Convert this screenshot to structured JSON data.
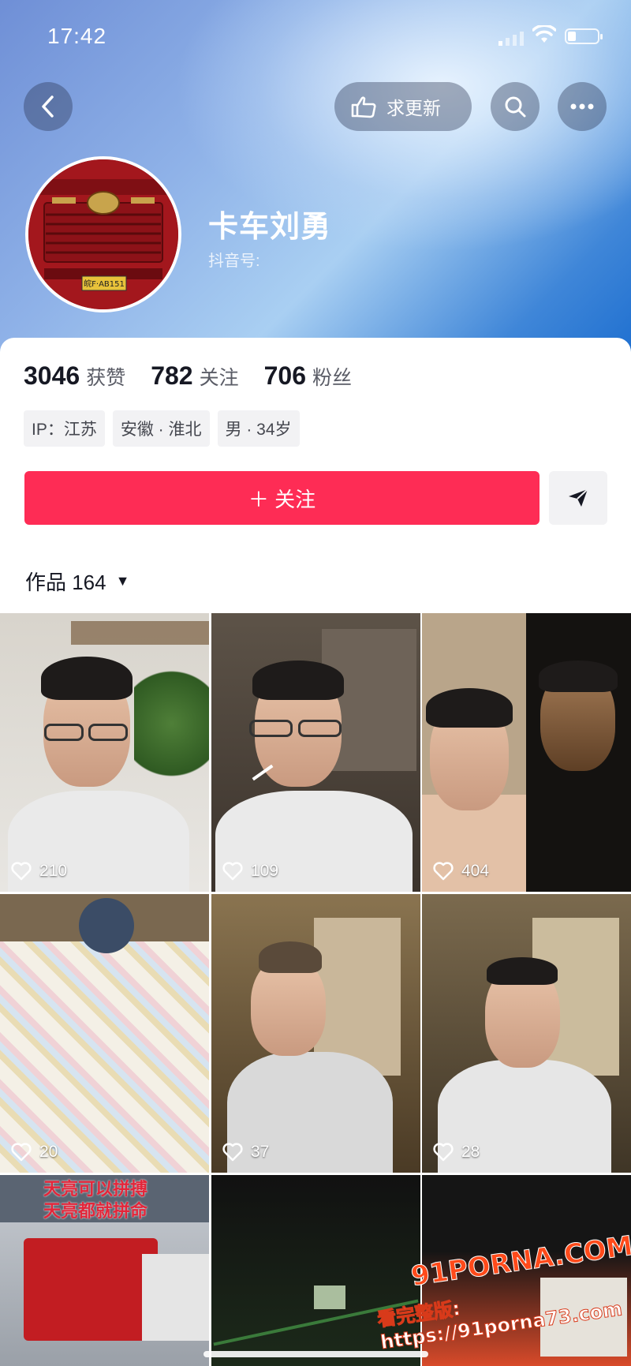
{
  "status_bar": {
    "time": "17:42"
  },
  "header": {
    "back_icon": "chevron-left-icon",
    "update_button_label": "求更新",
    "search_icon": "search-icon",
    "more_icon": "more-icon"
  },
  "profile": {
    "name": "卡车刘勇",
    "douyin_id_label": "抖音号:",
    "plate_text": "皖F·AB151"
  },
  "stats": [
    {
      "value": "3046",
      "label": "获赞"
    },
    {
      "value": "782",
      "label": "关注"
    },
    {
      "value": "706",
      "label": "粉丝"
    }
  ],
  "tags": [
    "IP：江苏",
    "安徽 · 淮北",
    "男 · 34岁"
  ],
  "actions": {
    "follow_label": "＋ 关注"
  },
  "works": {
    "label": "作品 164"
  },
  "videos": [
    {
      "likes": "210"
    },
    {
      "likes": "109"
    },
    {
      "likes": "404"
    },
    {
      "likes": "20"
    },
    {
      "likes": "37"
    },
    {
      "likes": "28"
    },
    {
      "likes": "",
      "overlay": [
        "天亮可以拼搏",
        "天亮都就拼命"
      ]
    },
    {
      "likes": ""
    },
    {
      "likes": "",
      "overlay": [
        "91PORNA.COM",
        "看完整版: https://91porna73.com"
      ]
    }
  ],
  "colors": {
    "accent": "#fe2c55",
    "text": "#161823"
  }
}
